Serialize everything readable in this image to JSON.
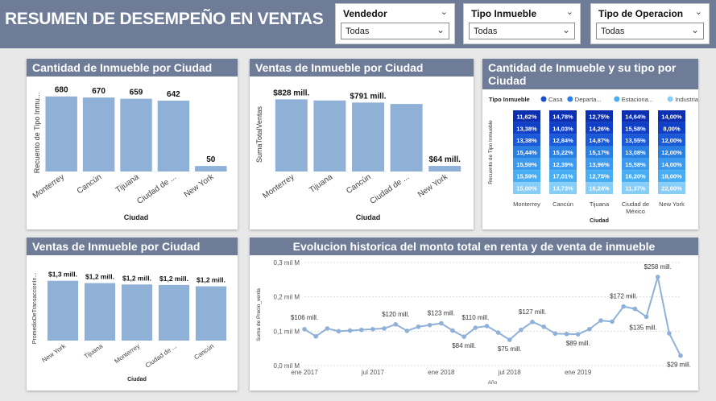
{
  "header": {
    "title": "RESUMEN DE DESEMPEÑO EN VENTAS"
  },
  "slicers": [
    {
      "label": "Vendedor",
      "value": "Todas"
    },
    {
      "label": "Tipo Inmueble",
      "value": "Todas"
    },
    {
      "label": "Tipo de Operacion",
      "value": "Todas"
    }
  ],
  "icons": {
    "collapse": "chevron-down-icon",
    "dropdown": "chevron-down-icon"
  },
  "colors": {
    "bar": "#8fb1d7",
    "header": "#6e7c98",
    "line": "#8fb1d7",
    "casa": "#1a4fc8",
    "departamento": "#2a7fe3",
    "estacionamiento": "#48aef3",
    "industrial": "#86cdf8"
  },
  "chart_data": [
    {
      "type": "bar",
      "title": "Cantidad de Inmueble por Ciudad",
      "xlabel": "Ciudad",
      "ylabel": "Recuento de Tipo Inmu...",
      "categories": [
        "Monterrey",
        "Cancún",
        "Tijuana",
        "Ciudad de ...",
        "New York"
      ],
      "values": [
        680,
        670,
        659,
        642,
        50
      ],
      "data_labels": [
        "680",
        "670",
        "659",
        "642",
        "50"
      ],
      "ylim": [
        0,
        700
      ]
    },
    {
      "type": "bar",
      "title": "Ventas de Inmueble por Ciudad",
      "xlabel": "Ciudad",
      "ylabel": "SumaTotalVentas",
      "categories": [
        "Monterrey",
        "Tijuana",
        "Cancún",
        "Ciudad de ...",
        "New York"
      ],
      "values": [
        828,
        815,
        791,
        775,
        64
      ],
      "data_labels": [
        "$828 mill.",
        "",
        "$791 mill.",
        "",
        "$64 mill."
      ],
      "ylim": [
        0,
        850
      ]
    },
    {
      "type": "bar",
      "title": "Cantidad de Inmueble y su tipo por Ciudad",
      "stacked": "100%",
      "xlabel": "Ciudad",
      "ylabel": "Recuento de Tipo Inmueble",
      "legend_title": "Tipo Inmueble",
      "legend_position": "top-left",
      "categories": [
        "Monterrey",
        "Cancún",
        "Tijuana",
        "Ciudad de México",
        "New York"
      ],
      "series": [
        {
          "name": "Casa",
          "segments": [
            [
              "11,62%",
              "13,38%",
              "13,38%",
              "15,44%",
              "15,59%",
              "15,59%",
              "15,00%"
            ],
            [
              "14,78%",
              "14,03%",
              "12,84%",
              "15,22%",
              "12,39%",
              "17,01%",
              "13,73%"
            ],
            [
              "12,75%",
              "14,26%",
              "14,87%",
              "15,17%",
              "13,96%",
              "12,75%",
              "16,24%"
            ],
            [
              "14,64%",
              "15,58%",
              "13,55%",
              "13,08%",
              "15,58%",
              "16,20%",
              "11,37%"
            ],
            [
              "14,00%",
              "8,00%",
              "12,00%",
              "12,00%",
              "14,00%",
              "18,00%",
              "22,00%"
            ]
          ]
        }
      ],
      "legend": [
        "Casa",
        "Departa...",
        "Estaciona...",
        "Industrial"
      ]
    },
    {
      "type": "bar",
      "title": "Ventas de Inmueble por Ciudad",
      "xlabel": "Ciudad",
      "ylabel": "PromedioDeTransaccionIn...",
      "categories": [
        "New York",
        "Tijuana",
        "Monterrey",
        "Ciudad de ...",
        "Cancún"
      ],
      "values": [
        1.3,
        1.25,
        1.22,
        1.21,
        1.18
      ],
      "data_labels": [
        "$1,3 mill.",
        "$1,2 mill.",
        "$1,2 mill.",
        "$1,2 mill.",
        "$1,2 mill."
      ],
      "ylim": [
        0,
        1.4
      ]
    },
    {
      "type": "line",
      "title": "Evolucion historica del monto total en renta y de venta de inmueble",
      "xlabel": "Año",
      "ylabel": "Suma de Precio_venta",
      "x_ticks": [
        "ene 2017",
        "jul 2017",
        "ene 2018",
        "jul 2018",
        "ene 2019"
      ],
      "y_ticks": [
        "0,0 mil M",
        "0,1 mil M",
        "0,2 mil M",
        "0,3 mil M"
      ],
      "ylim": [
        0,
        300
      ],
      "values": [
        106,
        85,
        108,
        100,
        102,
        104,
        106,
        108,
        120,
        101,
        113,
        118,
        123,
        102,
        84,
        110,
        115,
        96,
        75,
        104,
        127,
        113,
        93,
        92,
        91,
        106,
        131,
        128,
        172,
        165,
        142,
        258,
        94,
        29
      ],
      "annotations": [
        {
          "index": 0,
          "label": "$106 mill."
        },
        {
          "index": 8,
          "label": "$120 mill."
        },
        {
          "index": 12,
          "label": "$123 mill."
        },
        {
          "index": 14,
          "label": "$84 mill."
        },
        {
          "index": 15,
          "label": "$110 mill."
        },
        {
          "index": 18,
          "label": "$75 mill."
        },
        {
          "index": 20,
          "label": "$127 mill."
        },
        {
          "index": 24,
          "label": "$89 mill."
        },
        {
          "index": 28,
          "label": "$172 mill."
        },
        {
          "index": 30,
          "label": "$135 mill."
        },
        {
          "index": 31,
          "label": "$258 mill."
        },
        {
          "index": 33,
          "label": "$29 mill."
        }
      ]
    }
  ]
}
